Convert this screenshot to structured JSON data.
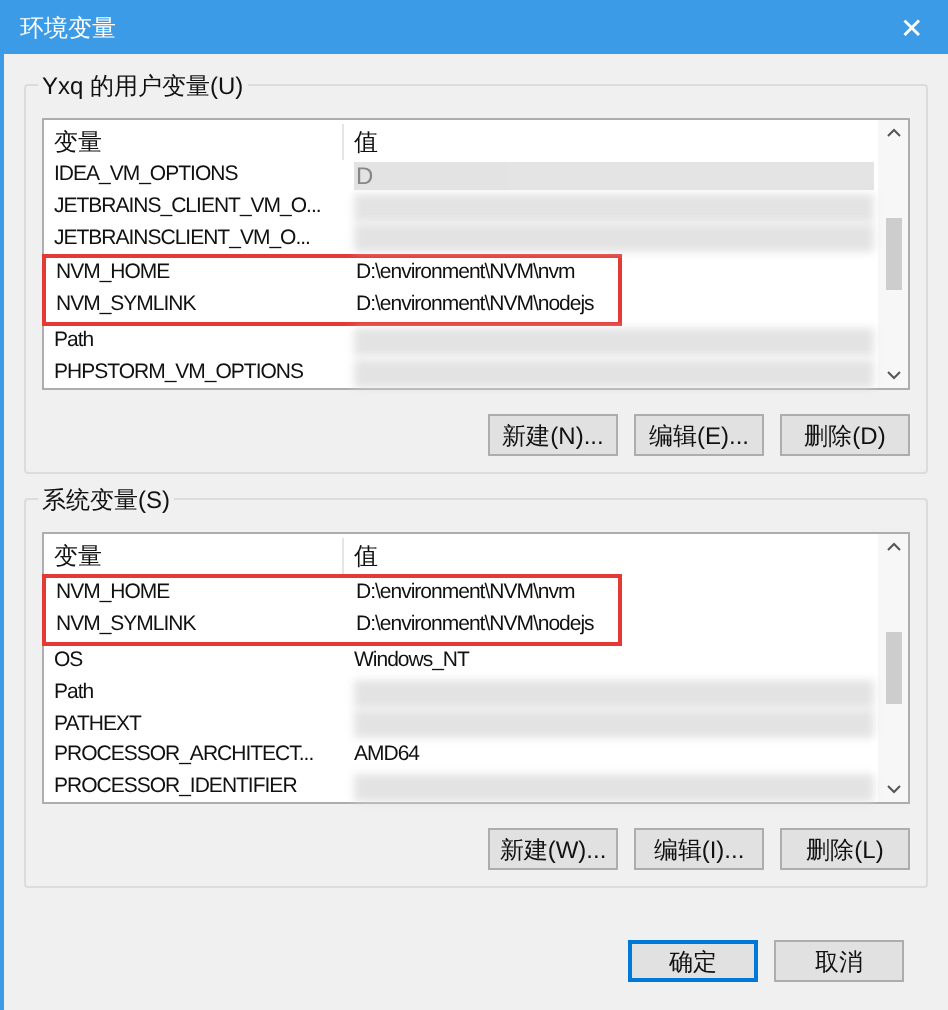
{
  "window": {
    "title": "环境变量",
    "close": "✕"
  },
  "sections": [
    {
      "label": "Yxq 的用户变量(U)",
      "columns": [
        "变量",
        "值"
      ],
      "rows": [
        {
          "name": "IDEA_VM_OPTIONS",
          "value": "D",
          "blurred": true,
          "highlighted": false
        },
        {
          "name": "JETBRAINS_CLIENT_VM_O...",
          "value": "",
          "blurred": true,
          "highlighted": false
        },
        {
          "name": "JETBRAINSCLIENT_VM_O...",
          "value": "",
          "blurred": true,
          "highlighted": false
        },
        {
          "name": "NVM_HOME",
          "value": "D:\\environment\\NVM\\nvm",
          "blurred": false,
          "highlighted": true
        },
        {
          "name": "NVM_SYMLINK",
          "value": "D:\\environment\\NVM\\nodejs",
          "blurred": false,
          "highlighted": true
        },
        {
          "name": "Path",
          "value": "",
          "blurred": true,
          "highlighted": false
        },
        {
          "name": "PHPSTORM_VM_OPTIONS",
          "value": "",
          "blurred": true,
          "highlighted": false
        }
      ],
      "buttons": [
        "新建(N)...",
        "编辑(E)...",
        "删除(D)"
      ]
    },
    {
      "label": "系统变量(S)",
      "columns": [
        "变量",
        "值"
      ],
      "rows": [
        {
          "name": "NVM_HOME",
          "value": "D:\\environment\\NVM\\nvm",
          "blurred": false,
          "highlighted": true
        },
        {
          "name": "NVM_SYMLINK",
          "value": "D:\\environment\\NVM\\nodejs",
          "blurred": false,
          "highlighted": true
        },
        {
          "name": "OS",
          "value": "Windows_NT",
          "blurred": false,
          "highlighted": false
        },
        {
          "name": "Path",
          "value": "",
          "blurred": true,
          "highlighted": false
        },
        {
          "name": "PATHEXT",
          "value": "",
          "blurred": true,
          "highlighted": false
        },
        {
          "name": "PROCESSOR_ARCHITECT...",
          "value": "AMD64",
          "blurred": false,
          "highlighted": false
        },
        {
          "name": "PROCESSOR_IDENTIFIER",
          "value": "",
          "blurred": true,
          "highlighted": false
        }
      ],
      "buttons": [
        "新建(W)...",
        "编辑(I)...",
        "删除(L)"
      ]
    }
  ],
  "footer_buttons": [
    {
      "label": "确定",
      "default": true
    },
    {
      "label": "取消",
      "default": false
    }
  ]
}
